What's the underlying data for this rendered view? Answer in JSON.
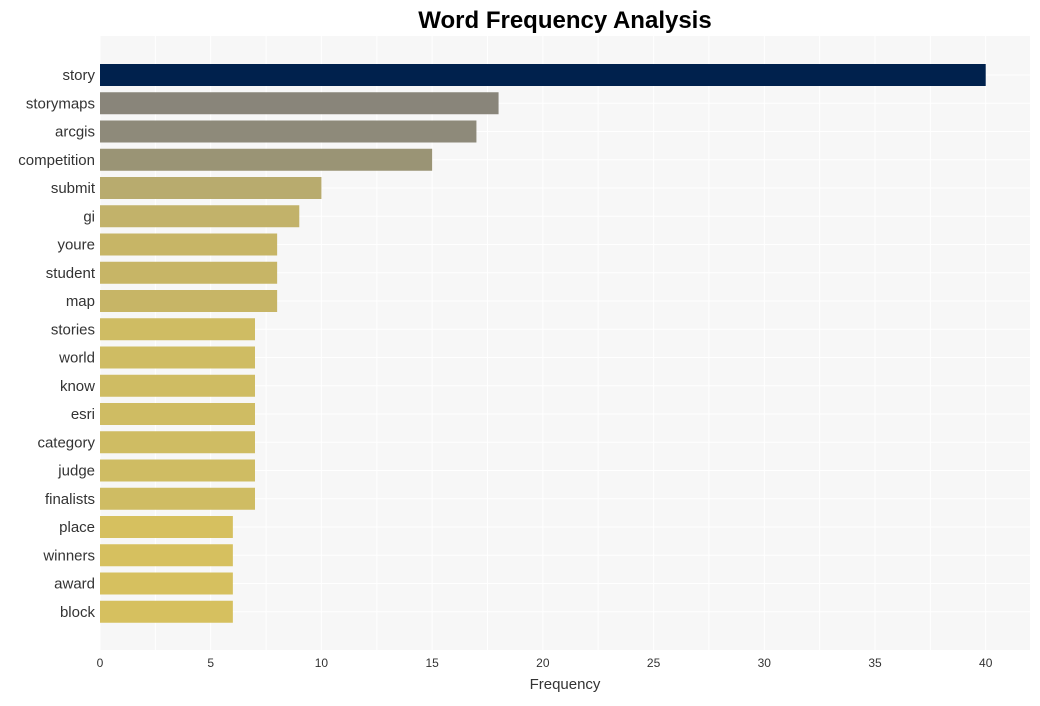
{
  "chart_data": {
    "type": "bar",
    "orientation": "horizontal",
    "title": "Word Frequency Analysis",
    "xlabel": "Frequency",
    "ylabel": "",
    "xlim": [
      0,
      42
    ],
    "xticks": [
      0,
      5,
      10,
      15,
      20,
      25,
      30,
      35,
      40
    ],
    "grid": true,
    "legend": "none",
    "categories": [
      "story",
      "storymaps",
      "arcgis",
      "competition",
      "submit",
      "gi",
      "youre",
      "student",
      "map",
      "stories",
      "world",
      "know",
      "esri",
      "category",
      "judge",
      "finalists",
      "place",
      "winners",
      "award",
      "block"
    ],
    "values": [
      40,
      18,
      17,
      15,
      10,
      9,
      8,
      8,
      8,
      7,
      7,
      7,
      7,
      7,
      7,
      7,
      6,
      6,
      6,
      6
    ],
    "colors": [
      "#00214d",
      "#89857a",
      "#8e8a7a",
      "#9a9475",
      "#b8ab6e",
      "#c2b26a",
      "#c7b566",
      "#c7b566",
      "#c7b566",
      "#cfbc63",
      "#cfbc63",
      "#cfbc63",
      "#cfbc63",
      "#cfbc63",
      "#cfbc63",
      "#cfbc63",
      "#d6c05f",
      "#d6c05f",
      "#d6c05f",
      "#d6c05f"
    ],
    "plot_background": "#f7f7f7"
  }
}
